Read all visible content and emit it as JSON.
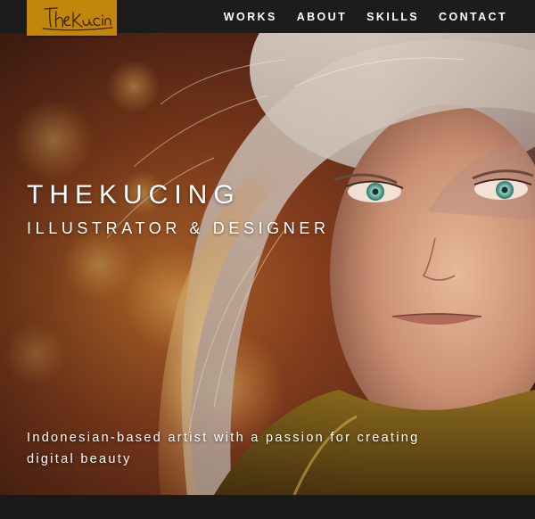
{
  "logo": {
    "text": "theKucing",
    "color": "#c2860b"
  },
  "nav": {
    "items": [
      {
        "label": "WORKS"
      },
      {
        "label": "ABOUT"
      },
      {
        "label": "SKILLS"
      },
      {
        "label": "CONTACT"
      }
    ]
  },
  "hero": {
    "title": "THEKUCING",
    "subtitle": "ILLUSTRATOR & DESIGNER",
    "tagline": "Indonesian-based artist with a passion for creating digital beauty"
  },
  "colors": {
    "navbar": "#1c1c1c",
    "accent": "#c2860b",
    "text": "#ffffff"
  }
}
